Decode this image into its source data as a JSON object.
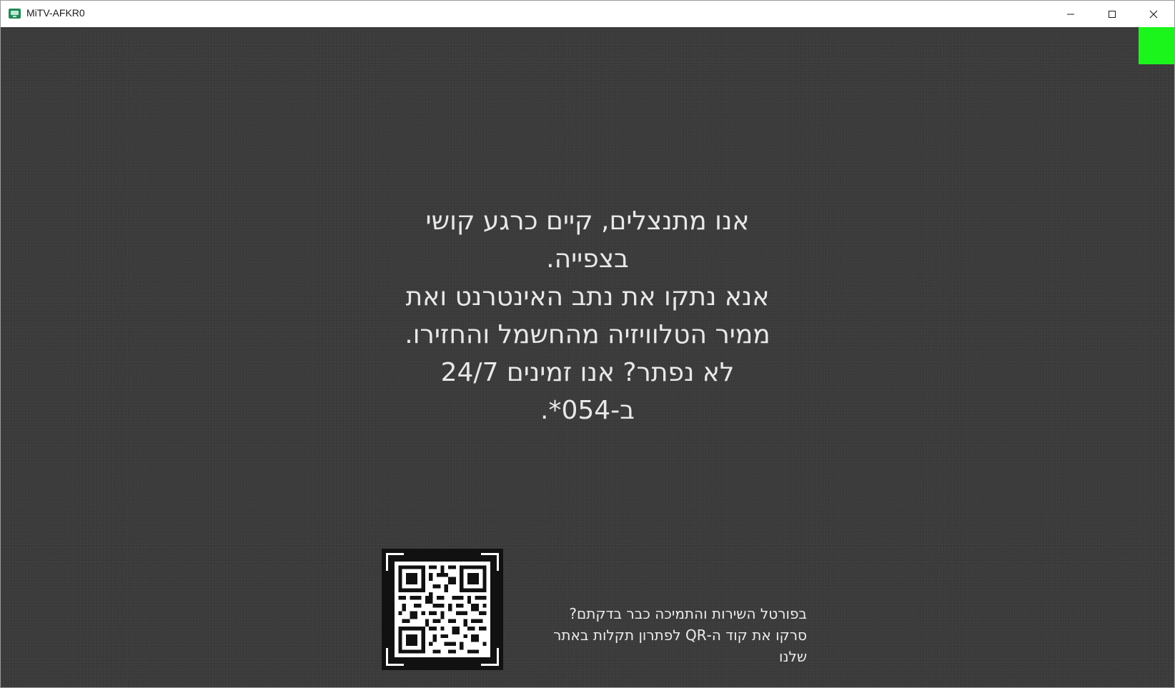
{
  "window": {
    "title": "MiTV-AFKR0",
    "icon": "tv-app-icon",
    "controls": {
      "minimize": "minimize-icon",
      "maximize": "maximize-icon",
      "close": "close-icon"
    }
  },
  "content": {
    "status_indicator_color": "#1cf51c",
    "message_lines": [
      "אנו מתנצלים, קיים כרגע קושי",
      "בצפייה.",
      "אנא נתקו את נתב האינטרנט ואת",
      "ממיר הטלוויזיה מהחשמל והחזירו.",
      "לא נפתר? אנו זמינים 24/7",
      "ב-054*."
    ],
    "qr": {
      "text_lines": [
        "בפורטל השירות והתמיכה כבר בדקתם?",
        "סרקו את קוד ה-QR לפתרון תקלות באתר",
        "שלנו"
      ]
    }
  }
}
